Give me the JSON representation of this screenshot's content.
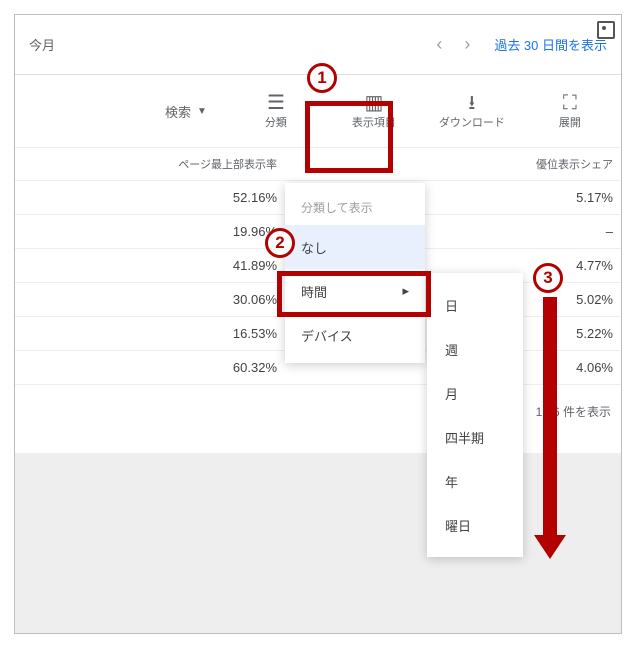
{
  "header": {
    "period": "今月",
    "link_text": "過去 30 日間を表示"
  },
  "toolbar": {
    "search_label": "検索",
    "items": [
      {
        "label": "分類",
        "icon_glyph": "☰"
      },
      {
        "label": "表示項目",
        "icon_glyph": "▥"
      },
      {
        "label": "ダウンロード",
        "icon_glyph": "⭳"
      },
      {
        "label": "展開",
        "icon_glyph": "⛶"
      }
    ]
  },
  "columns": {
    "left": "ページ最上部表示率",
    "right": "優位表示シェア"
  },
  "rows": [
    {
      "left": "52.16%",
      "right": "5.17%"
    },
    {
      "left": "19.96%",
      "right": "–"
    },
    {
      "left": "41.89%",
      "right": "4.77%"
    },
    {
      "left": "30.06%",
      "right": "5.02%"
    },
    {
      "left": "16.53%",
      "right": "5.22%"
    },
    {
      "left": "60.32%",
      "right": "4.06%"
    }
  ],
  "footer": {
    "text": "1 - 6 件を表示"
  },
  "menu": {
    "header": "分類して表示",
    "items": [
      {
        "label": "なし"
      },
      {
        "label": "時間",
        "has_sub": true
      },
      {
        "label": "デバイス"
      }
    ]
  },
  "submenu": {
    "items": [
      "日",
      "週",
      "月",
      "四半期",
      "年",
      "曜日"
    ]
  },
  "annotations": {
    "n1": "1",
    "n2": "2",
    "n3": "3"
  }
}
